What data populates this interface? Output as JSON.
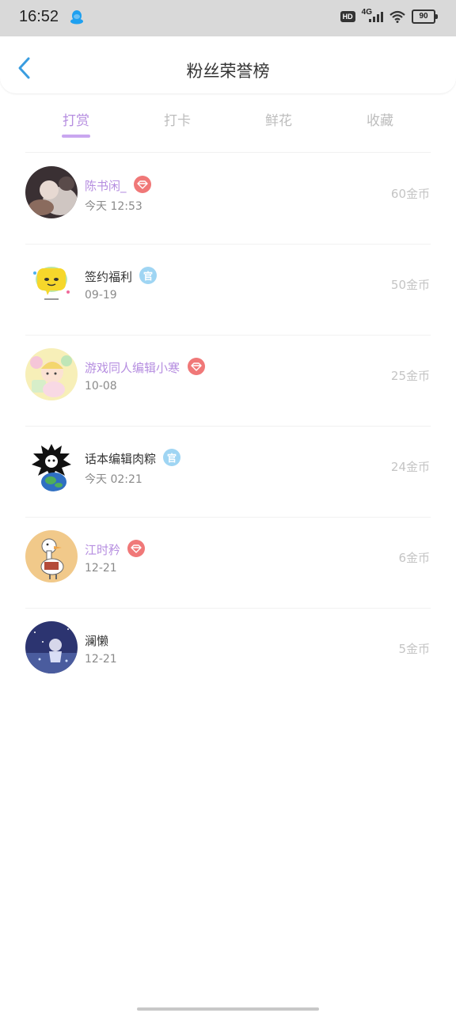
{
  "status": {
    "time": "16:52",
    "hd": "HD",
    "network": "4G",
    "battery": "90"
  },
  "header": {
    "title": "粉丝荣誉榜"
  },
  "tabs": [
    {
      "label": "打赏",
      "active": true
    },
    {
      "label": "打卡",
      "active": false
    },
    {
      "label": "鲜花",
      "active": false
    },
    {
      "label": "收藏",
      "active": false
    }
  ],
  "official_badge_text": "官",
  "supporters": [
    {
      "name": "陈书闲_",
      "date": "今天  12:53",
      "coins": "60金币",
      "badge": "diamond",
      "vip": true
    },
    {
      "name": "签约福利",
      "date": "09-19",
      "coins": "50金币",
      "badge": "official",
      "vip": false
    },
    {
      "name": "游戏同人编辑小寒",
      "date": "10-08",
      "coins": "25金币",
      "badge": "diamond",
      "vip": true
    },
    {
      "name": "话本编辑肉粽",
      "date": "今天  02:21",
      "coins": "24金币",
      "badge": "official",
      "vip": false
    },
    {
      "name": "江时矜",
      "date": "12-21",
      "coins": "6金币",
      "badge": "diamond",
      "vip": true
    },
    {
      "name": "澜懒",
      "date": "12-21",
      "coins": "5金币",
      "badge": "none",
      "vip": false
    }
  ],
  "colors": {
    "accent": "#b68ee0",
    "diamond_badge": "#f07878",
    "official_badge": "#9fd5f3",
    "back_arrow": "#3a9de0"
  }
}
